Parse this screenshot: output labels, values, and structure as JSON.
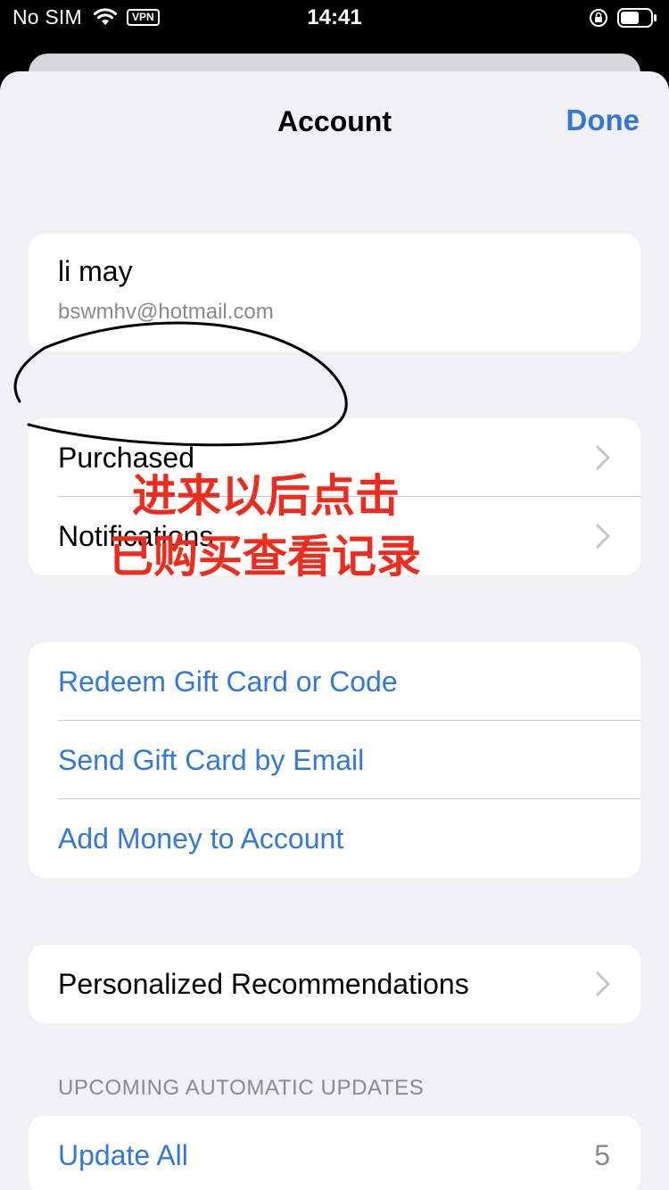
{
  "status_bar": {
    "carrier": "No SIM",
    "vpn": "VPN",
    "time": "14:41"
  },
  "nav": {
    "title": "Account",
    "done": "Done"
  },
  "account": {
    "name": "li may",
    "email": "bswmhv@hotmail.com"
  },
  "group1": {
    "purchased": "Purchased",
    "notifications": "Notifications"
  },
  "group2": {
    "redeem": "Redeem Gift Card or Code",
    "send_gift": "Send Gift Card by Email",
    "add_money": "Add Money to Account"
  },
  "group3": {
    "personalized": "Personalized Recommendations"
  },
  "updates": {
    "header": "UPCOMING AUTOMATIC UPDATES",
    "update_all": "Update All",
    "count": "5"
  },
  "annotation": {
    "line1": "进来以后点击",
    "line2": "已购买查看记录",
    "color": "#ee2c1e"
  },
  "colors": {
    "accent": "#3478d6",
    "background": "#f0f0f5"
  },
  "icons": [
    "wifi-icon",
    "orientation-lock-icon",
    "battery-icon",
    "chevron-right-icon"
  ]
}
